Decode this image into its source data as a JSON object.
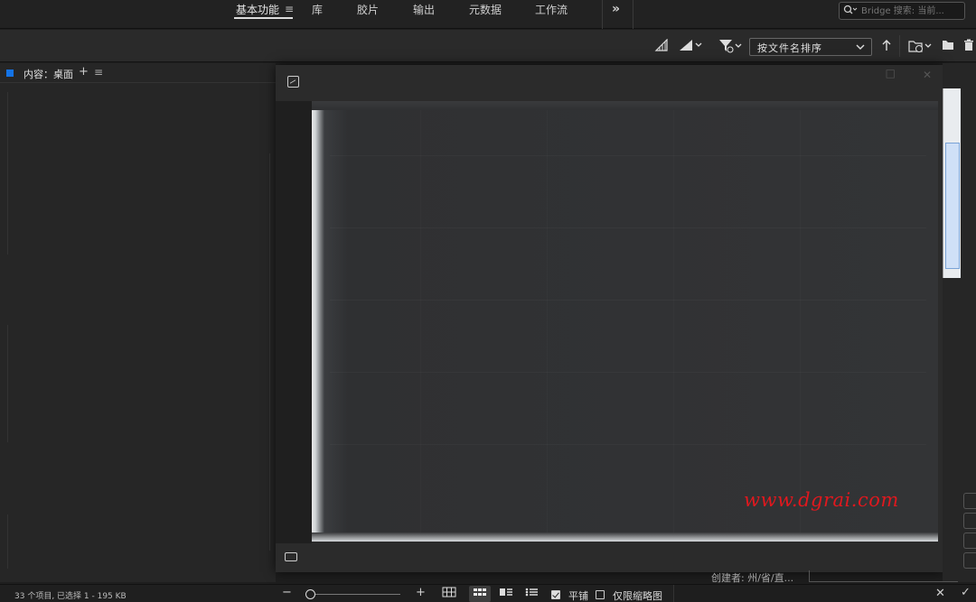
{
  "workspace_tabs": [
    {
      "label": "基本功能",
      "active": true
    },
    {
      "label": "库"
    },
    {
      "label": "胶片"
    },
    {
      "label": "输出"
    },
    {
      "label": "元数据"
    },
    {
      "label": "工作流"
    }
  ],
  "workspace_menu_glyph": "≡",
  "more_glyph": "»",
  "search": {
    "placeholder": "Bridge 搜索: 当前...",
    "icon": "search-icon"
  },
  "toolbar": {
    "sort_label": "按文件名排序",
    "icons": [
      "rating-filter-icon",
      "quality-icon",
      "filter-icon",
      "sort-ascending-icon",
      "recent-folder-icon",
      "new-folder-icon",
      "trash-icon"
    ]
  },
  "content_panel": {
    "title": "内容：桌面",
    "add_glyph": "+",
    "menu_glyph": "≡"
  },
  "preview": {
    "watermark": "www.dgrai.com"
  },
  "metadata": {
    "creator_label": "创建者: 州/省/直..."
  },
  "status": {
    "text": "33 个项目, 已选择 1 - 195 KB",
    "zoom_out": "−",
    "zoom_in": "+",
    "tile_label": "平铺",
    "tile_checked": true,
    "thumb_only_label": "仅限缩略图",
    "thumb_only_checked": false,
    "cancel": "✕",
    "confirm": "✓"
  },
  "colors": {
    "accent": "#1473e6",
    "watermark": "#e0181e"
  }
}
